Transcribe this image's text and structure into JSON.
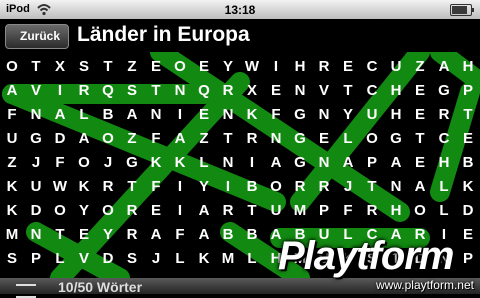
{
  "status_bar": {
    "carrier": "iPod",
    "time": "13:18"
  },
  "nav": {
    "back_label": "Zurück",
    "title": "Länder in Europa"
  },
  "grid_rows": [
    "OTXSTZEOEYWIHRECUZAH",
    "AVIRQSTNQRXENVTCHEGP",
    "FNALBANIENKFGNYUHERT",
    "UGDAOZFAZTRNGELOGTCE",
    "ZJFOJGKKLNIAGNAPAEHB",
    "KUWKRTFIYIBORRJTNALK",
    "KDOYOREIARTUMPFRHOLD",
    "MNTEYRAFABBABULCARIE",
    "SPLVDSJLKMLHMUKSTDNP"
  ],
  "bottom_bar": {
    "found_count": "10/50 Wörter"
  },
  "watermark": {
    "brand": "Playtform",
    "site": "www.playtform.net"
  },
  "colors": {
    "highlight": "#1aa31a",
    "background": "#000000"
  }
}
